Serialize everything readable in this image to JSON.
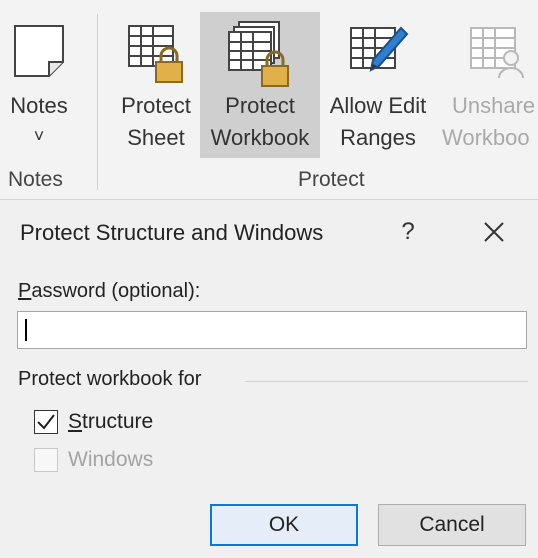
{
  "ribbon": {
    "notes_button": {
      "label": "Notes",
      "arrow": "˅"
    },
    "notes_group_label": "Notes",
    "protect_sheet_label": [
      "Protect",
      "Sheet"
    ],
    "protect_workbook_label": [
      "Protect",
      "Workbook"
    ],
    "allow_edit_ranges_label": [
      "Allow Edit",
      "Ranges"
    ],
    "unshare_workbook_label": [
      "Unshare",
      "Workboo"
    ],
    "protect_group_label": "Protect"
  },
  "dialog": {
    "title": "Protect Structure and Windows",
    "help_label": "?",
    "password_label_first": "P",
    "password_label_rest": "assword (optional):",
    "password_value": "",
    "section_label": "Protect workbook for",
    "structure": {
      "first": "S",
      "rest": "tructure",
      "checked": true
    },
    "windows": {
      "first": "W",
      "rest": "indows",
      "checked": false,
      "enabled": false
    },
    "ok_label": "OK",
    "cancel_label": "Cancel"
  },
  "colors": {
    "accent": "#0a78d7",
    "lock": "#e2b04a",
    "pencil": "#2f7fd1"
  },
  "icons": [
    "note-icon",
    "protect-sheet-icon",
    "protect-workbook-icon",
    "allow-edit-ranges-icon",
    "unshare-workbook-icon",
    "close-icon",
    "checkmark-icon"
  ]
}
